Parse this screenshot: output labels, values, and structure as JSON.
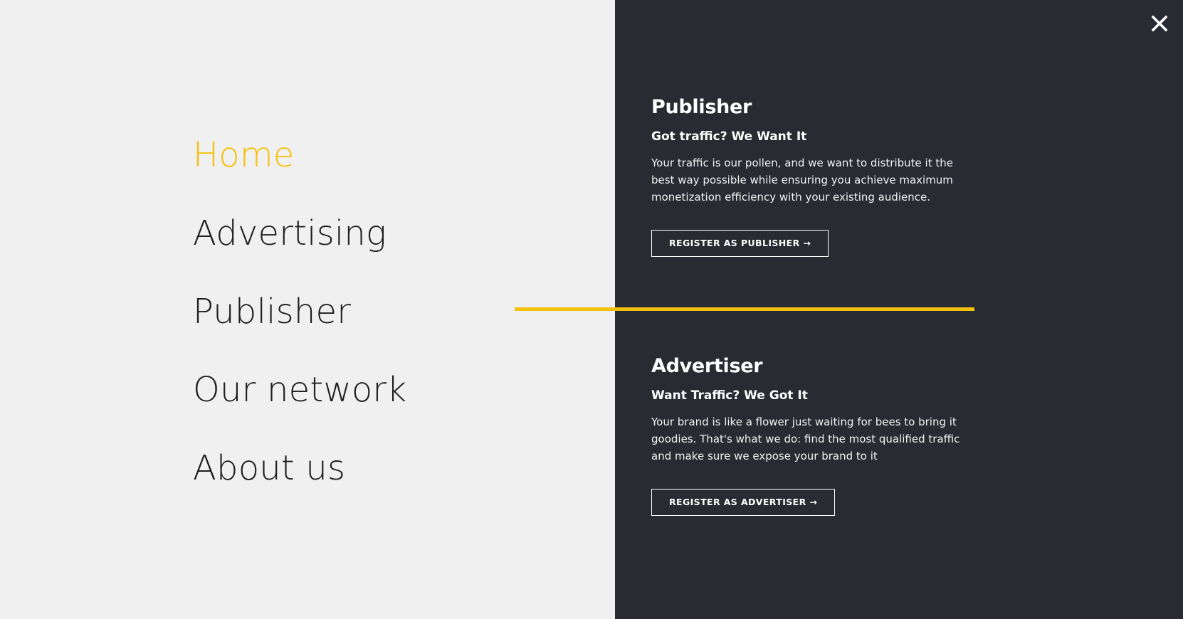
{
  "nav": {
    "items": [
      {
        "label": "Home",
        "active": true
      },
      {
        "label": "Advertising",
        "active": false
      },
      {
        "label": "Publisher",
        "active": false
      },
      {
        "label": "Our network",
        "active": false
      },
      {
        "label": "About us",
        "active": false
      }
    ]
  },
  "close": {
    "icon": "close-icon"
  },
  "publisher": {
    "title": "Publisher",
    "subtitle": "Got traffic? We Want It",
    "text": "Your traffic is our pollen, and we want to distribute it the best way possible while ensuring you achieve maximum monetization efficiency with your existing audience.",
    "button_label": "REGISTER AS PUBLISHER →"
  },
  "advertiser": {
    "title": "Advertiser",
    "subtitle": "Want Traffic? We Got It",
    "text": "Your brand is like a flower just waiting for bees to bring it goodies. That's what we do: find the most qualified traffic and make sure we expose your brand to it",
    "button_label": "REGISTER AS ADVERTISER →"
  },
  "colors": {
    "accent": "#f5c10e",
    "dark_panel": "#292b33",
    "light_panel": "#f0f0f0",
    "text_dark": "#1f1f1f"
  }
}
